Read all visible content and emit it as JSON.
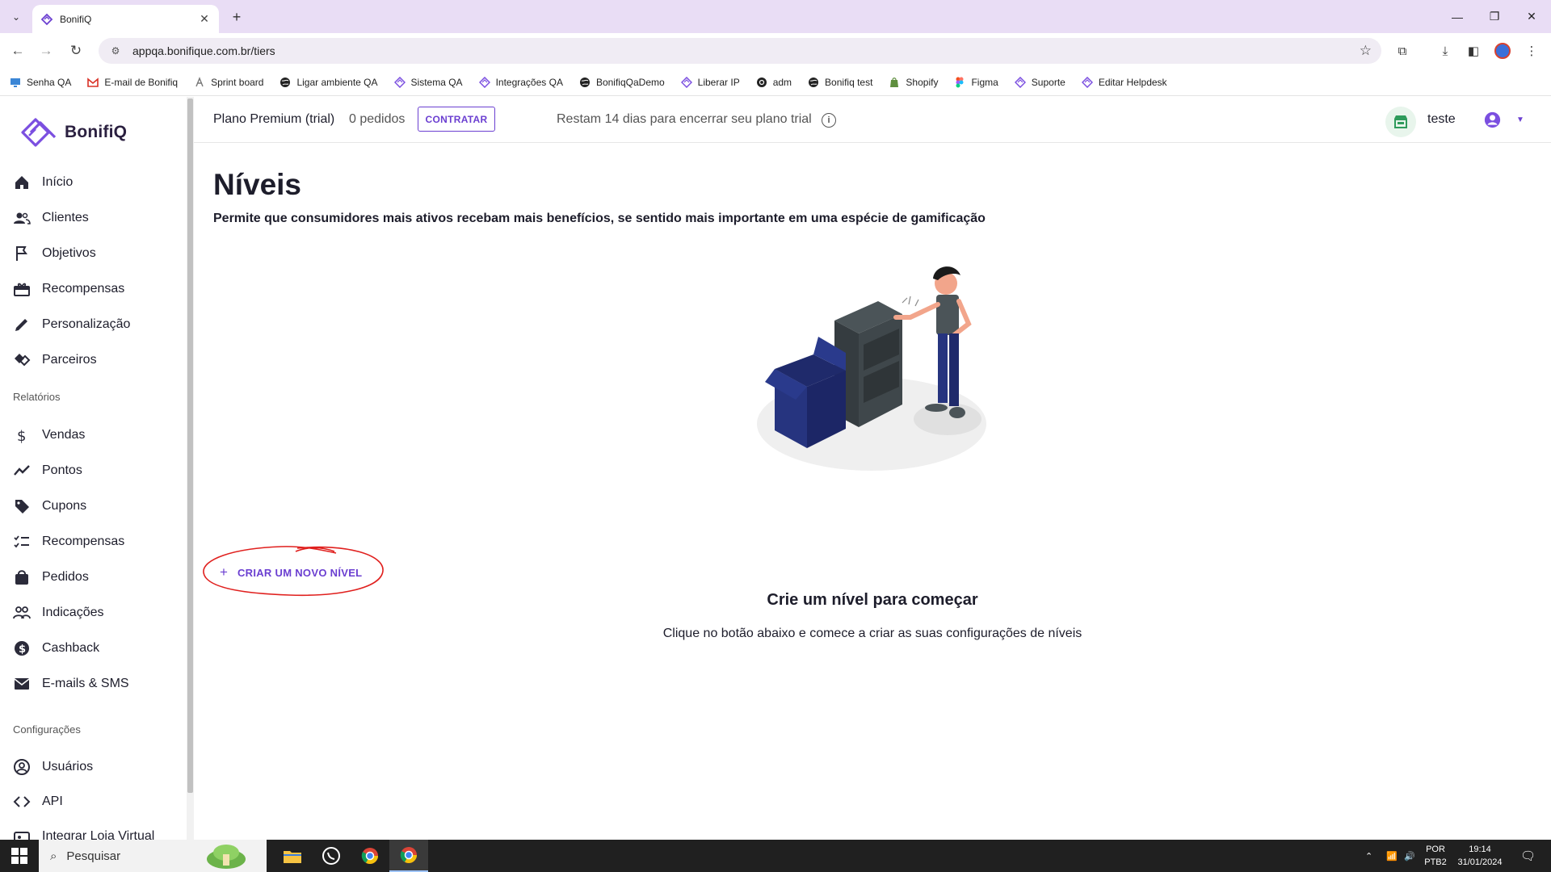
{
  "browser": {
    "tab_title": "BonifiQ",
    "url": "appqa.bonifique.com.br/tiers",
    "bookmarks": [
      {
        "label": "Senha QA",
        "icon": "monitor-icon"
      },
      {
        "label": "E-mail de Bonifiq",
        "icon": "gmail-icon"
      },
      {
        "label": "Sprint board",
        "icon": "sprint-icon"
      },
      {
        "label": "Ligar ambiente QA",
        "icon": "globe-icon"
      },
      {
        "label": "Sistema QA",
        "icon": "bonifiq-icon"
      },
      {
        "label": "Integrações QA",
        "icon": "bonifiq-icon"
      },
      {
        "label": "BonifiqQaDemo",
        "icon": "globe-icon"
      },
      {
        "label": "Liberar IP",
        "icon": "bonifiq-icon"
      },
      {
        "label": "adm",
        "icon": "eye-icon"
      },
      {
        "label": "Bonifiq test",
        "icon": "globe-icon"
      },
      {
        "label": "Shopify",
        "icon": "shopify-icon"
      },
      {
        "label": "Figma",
        "icon": "figma-icon"
      },
      {
        "label": "Suporte",
        "icon": "bonifiq-icon"
      },
      {
        "label": "Editar Helpdesk",
        "icon": "bonifiq-icon"
      }
    ]
  },
  "app": {
    "logo_text": "BonifiQ",
    "brand_color": "#6b3fd1",
    "sidebar": {
      "main_items": [
        {
          "label": "Início",
          "icon": "home-icon"
        },
        {
          "label": "Clientes",
          "icon": "users-icon"
        },
        {
          "label": "Objetivos",
          "icon": "flag-icon"
        },
        {
          "label": "Recompensas",
          "icon": "gift-icon"
        },
        {
          "label": "Personalização",
          "icon": "pencil-icon"
        },
        {
          "label": "Parceiros",
          "icon": "handshake-icon"
        }
      ],
      "reports_title": "Relatórios",
      "report_items": [
        {
          "label": "Vendas",
          "icon": "dollar-icon"
        },
        {
          "label": "Pontos",
          "icon": "trend-icon"
        },
        {
          "label": "Cupons",
          "icon": "tag-icon"
        },
        {
          "label": "Recompensas",
          "icon": "checklist-icon"
        },
        {
          "label": "Pedidos",
          "icon": "bag-icon"
        },
        {
          "label": "Indicações",
          "icon": "people-icon"
        },
        {
          "label": "Cashback",
          "icon": "coin-icon"
        },
        {
          "label": "E-mails & SMS",
          "icon": "mail-icon"
        }
      ],
      "settings_title": "Configurações",
      "settings_items": [
        {
          "label": "Usuários",
          "icon": "account-circle-icon"
        },
        {
          "label": "API",
          "icon": "code-icon"
        },
        {
          "label": "Integrar Loja Virtual",
          "icon": "store-icon"
        }
      ]
    },
    "topbar": {
      "plan_name": "Plano Premium (trial)",
      "orders": "0 pedidos",
      "contract_button": "CONTRATAR",
      "trial_message": "Restam 14 dias para encerrar seu plano trial",
      "store_name": "teste"
    },
    "page": {
      "title": "Níveis",
      "subtitle": "Permite que consumidores mais ativos recebam mais benefícios, se sentido mais importante em uma espécie de gamificação",
      "empty_title": "Crie um nível para começar",
      "empty_description": "Clique no botão abaixo e comece a criar as suas configurações de níveis",
      "create_button": "CRIAR UM NOVO NÍVEL"
    }
  },
  "taskbar": {
    "search_placeholder": "Pesquisar",
    "language_line1": "POR",
    "language_line2": "PTB2",
    "time": "19:14",
    "date": "31/01/2024"
  }
}
